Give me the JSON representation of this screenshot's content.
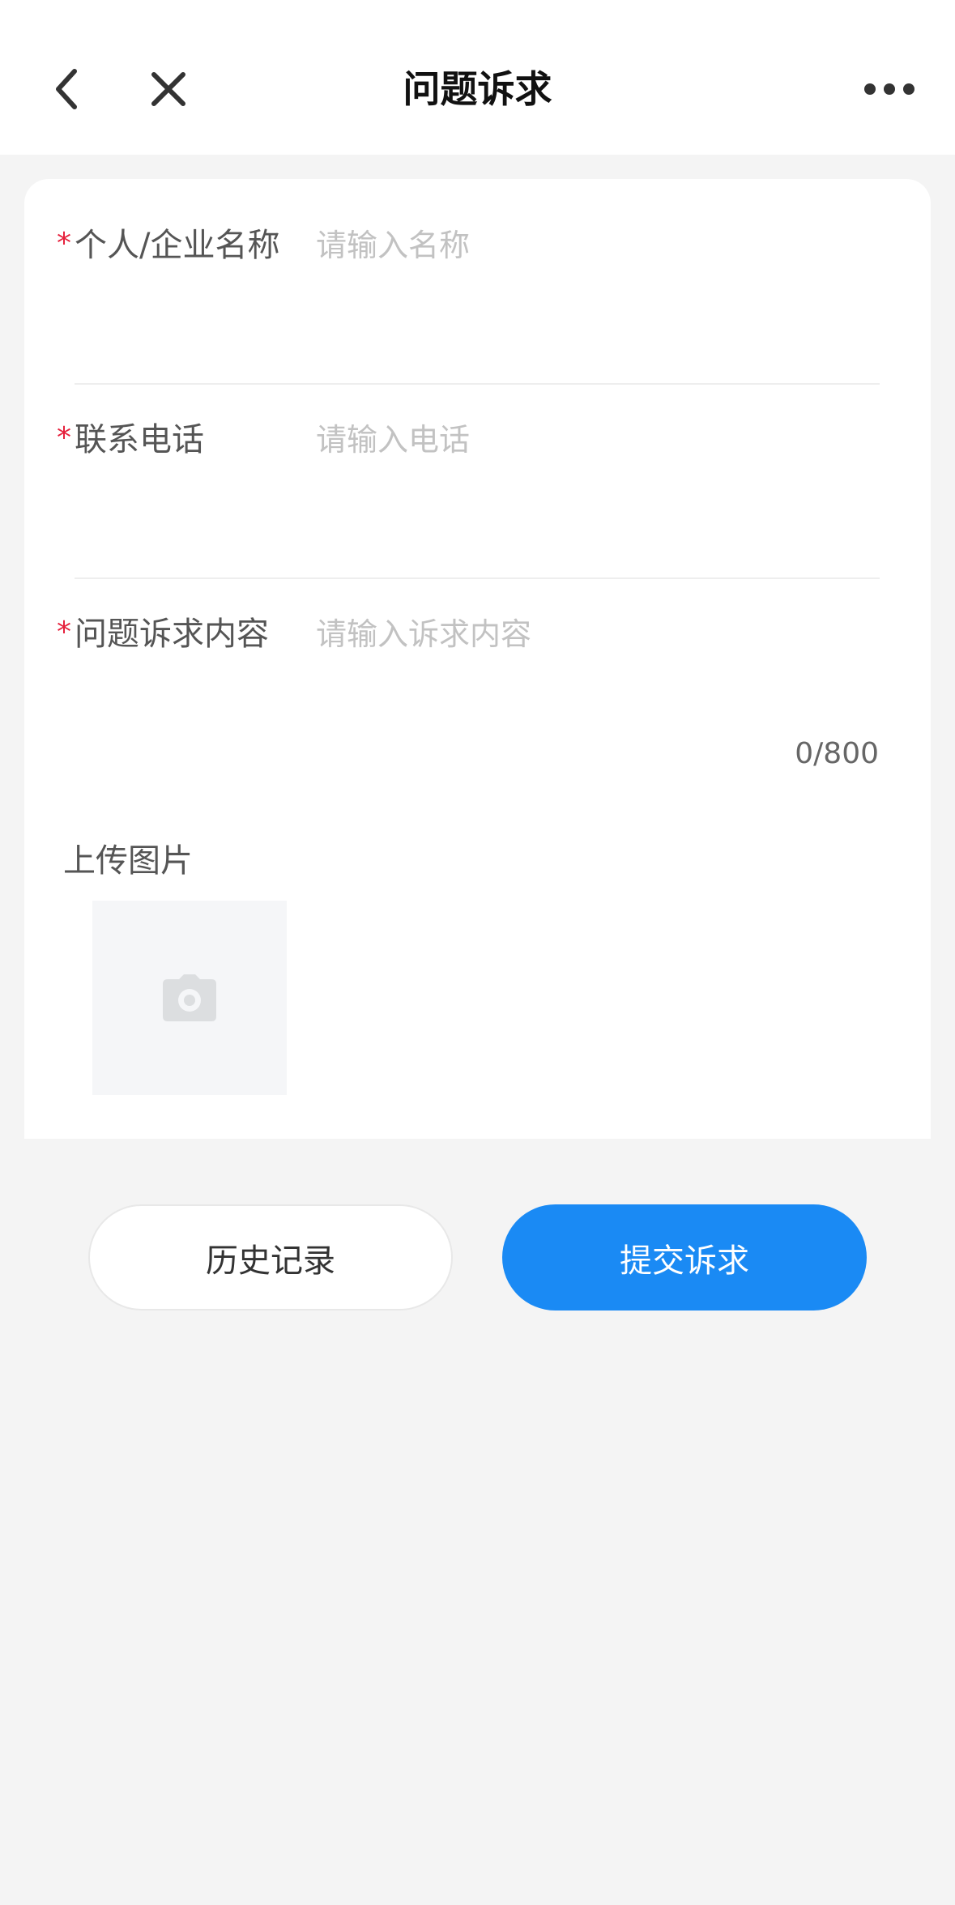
{
  "header": {
    "title": "问题诉求"
  },
  "form": {
    "name": {
      "required_mark": "*",
      "label": "个人/企业名称",
      "placeholder": "请输入名称",
      "value": ""
    },
    "phone": {
      "required_mark": "*",
      "label": "联系电话",
      "placeholder": "请输入电话",
      "value": ""
    },
    "content": {
      "required_mark": "*",
      "label": "问题诉求内容",
      "placeholder": "请输入诉求内容",
      "value": "",
      "counter": "0/800"
    },
    "upload": {
      "label": "上传图片"
    }
  },
  "actions": {
    "history_label": "历史记录",
    "submit_label": "提交诉求"
  },
  "colors": {
    "accent": "#1a8af4",
    "required": "#e6223d",
    "page_bg": "#f4f4f4"
  },
  "icons": {
    "back": "chevron-left-icon",
    "close": "close-icon",
    "more": "more-horizontal-icon",
    "camera": "camera-icon"
  }
}
